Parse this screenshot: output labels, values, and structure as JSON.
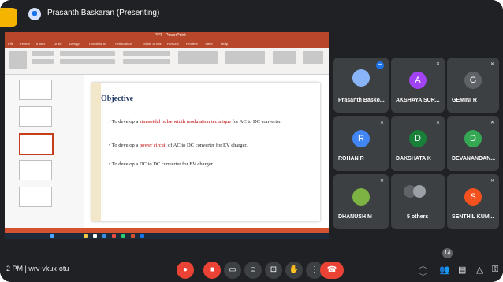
{
  "header": {
    "presenter_title": "Prasanth Baskaran (Presenting)"
  },
  "powerpoint": {
    "title": "PPT - PowerPoint",
    "tabs": [
      "File",
      "Home",
      "Insert",
      "Draw",
      "Design",
      "Transitions",
      "Animations",
      "Slide Show",
      "Record",
      "Review",
      "View",
      "Help"
    ],
    "slide": {
      "title": "Objective",
      "bullets": [
        {
          "pre": "To develop a ",
          "hl": "sinusoidal pulse width modulation technique",
          "post": " for AC to DC converter."
        },
        {
          "pre": "To develop a ",
          "hl": "power circuit",
          "post": " of AC to DC converter for EV charger."
        },
        {
          "pre": "To develop a DC to DC converter for EV charger.",
          "hl": "",
          "post": ""
        }
      ]
    }
  },
  "participants": [
    {
      "name": "Prasanth Basko...",
      "initial": "",
      "color": "#1a73e8"
    },
    {
      "name": "AKSHAYA SUR...",
      "initial": "A",
      "color": "#a142f4"
    },
    {
      "name": "GEMINI R",
      "initial": "G",
      "color": "#5f6368"
    },
    {
      "name": "ROHAN R",
      "initial": "R",
      "color": "#4285f4"
    },
    {
      "name": "DAKSHATA K",
      "initial": "D",
      "color": "#188038"
    },
    {
      "name": "DEVANANDAN...",
      "initial": "D",
      "color": "#34a853"
    },
    {
      "name": "DHANUSH M",
      "initial": "",
      "color": "#7cb342"
    },
    {
      "name": "5 others",
      "initial": "",
      "color": "#5f6368"
    },
    {
      "name": "SENTHIL KUM...",
      "initial": "S",
      "color": "#f4511e"
    }
  ],
  "bottom": {
    "time_meeting": "2 PM | wrv-vkux-otu",
    "participants_badge": "14"
  }
}
